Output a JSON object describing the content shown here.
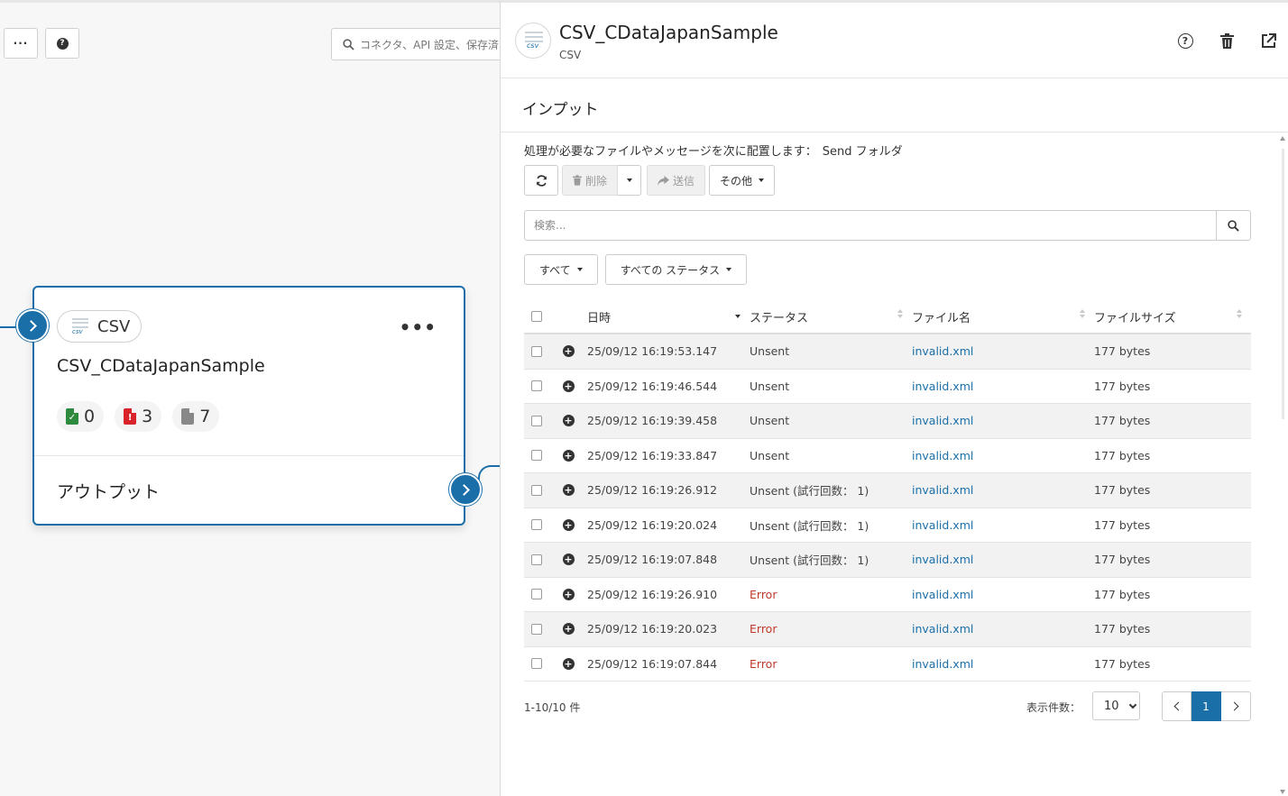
{
  "canvas": {
    "more_label": "···",
    "help_label": "?",
    "search_placeholder": "コネクタ、API 設定、保存済み",
    "node": {
      "type_label": "CSV",
      "type_icon_text": "csv",
      "more_label": "•••",
      "title": "CSV_CDataJapanSample",
      "counts": [
        {
          "value": "0",
          "icon": "file-check-icon",
          "color": "#2e8b3d"
        },
        {
          "value": "3",
          "icon": "file-error-icon",
          "color": "#d8232a"
        },
        {
          "value": "7",
          "icon": "file-icon",
          "color": "#888888"
        }
      ],
      "output_label": "アウトプット"
    }
  },
  "panel": {
    "header": {
      "icon_text": "csv",
      "title": "CSV_CDataJapanSample",
      "subtitle": "CSV",
      "help_label": "?"
    },
    "section_title": "インプット",
    "instruction": "処理が必要なファイルやメッセージを次に配置します：",
    "folder": "Send フォルダ",
    "toolbar": {
      "delete_label": "削除",
      "send_label": "送信",
      "other_label": "その他"
    },
    "search_placeholder": "検索...",
    "filters": {
      "type_label": "すべて",
      "status_label": "すべての ステータス"
    },
    "table": {
      "headers": {
        "date": "日時",
        "status": "ステータス",
        "name": "ファイル名",
        "size": "ファイルサイズ"
      },
      "rows": [
        {
          "date": "25/09/12 16:19:53.147",
          "status": "Unsent",
          "name": "invalid.xml",
          "size": "177 bytes",
          "error": false
        },
        {
          "date": "25/09/12 16:19:46.544",
          "status": "Unsent",
          "name": "invalid.xml",
          "size": "177 bytes",
          "error": false
        },
        {
          "date": "25/09/12 16:19:39.458",
          "status": "Unsent",
          "name": "invalid.xml",
          "size": "177 bytes",
          "error": false
        },
        {
          "date": "25/09/12 16:19:33.847",
          "status": "Unsent",
          "name": "invalid.xml",
          "size": "177 bytes",
          "error": false
        },
        {
          "date": "25/09/12 16:19:26.912",
          "status": "Unsent (試行回数： 1)",
          "name": "invalid.xml",
          "size": "177 bytes",
          "error": false
        },
        {
          "date": "25/09/12 16:19:20.024",
          "status": "Unsent (試行回数： 1)",
          "name": "invalid.xml",
          "size": "177 bytes",
          "error": false
        },
        {
          "date": "25/09/12 16:19:07.848",
          "status": "Unsent (試行回数： 1)",
          "name": "invalid.xml",
          "size": "177 bytes",
          "error": false
        },
        {
          "date": "25/09/12 16:19:26.910",
          "status": "Error",
          "name": "invalid.xml",
          "size": "177 bytes",
          "error": true
        },
        {
          "date": "25/09/12 16:19:20.023",
          "status": "Error",
          "name": "invalid.xml",
          "size": "177 bytes",
          "error": true
        },
        {
          "date": "25/09/12 16:19:07.844",
          "status": "Error",
          "name": "invalid.xml",
          "size": "177 bytes",
          "error": true
        }
      ]
    },
    "footer": {
      "range": "1-10/10 件",
      "page_size_label": "表示件数：",
      "page_size": "10",
      "current_page": "1"
    }
  },
  "colors": {
    "accent": "#1b6fa8",
    "error": "#c0392b",
    "success": "#2e8b3d",
    "danger": "#d8232a"
  }
}
